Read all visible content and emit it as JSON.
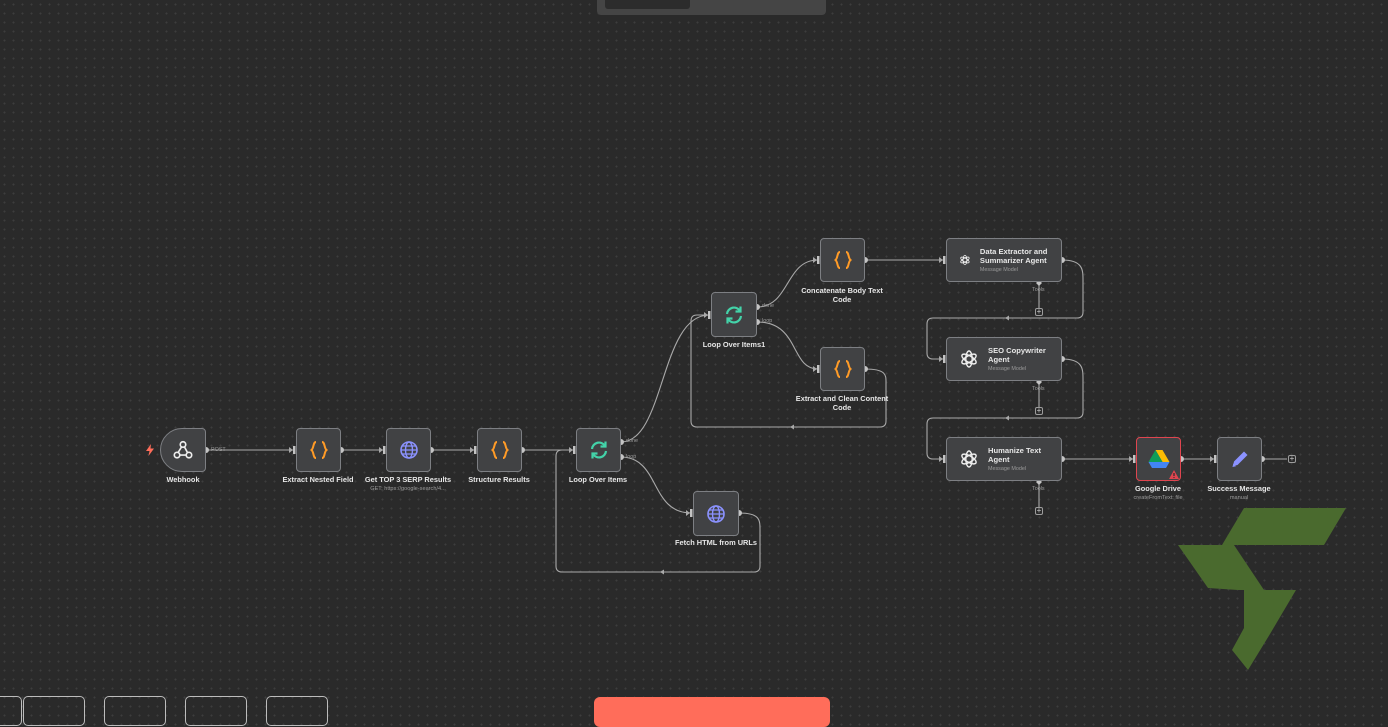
{
  "colors": {
    "canvas": "#2a2a2a",
    "node_fill": "#414244",
    "node_border": "#7d7f83",
    "edge": "#a9a9a9",
    "code_icon": "#ff9b27",
    "loop_icon": "#43d3a9",
    "http_icon": "#8b92ff",
    "set_icon": "#8b92ff",
    "error_border": "#e0454f",
    "primary_button": "#ff6d5a",
    "watermark": "#4a6a2e"
  },
  "nodes": {
    "webhook": {
      "label": "Webhook",
      "icon": "webhook-icon",
      "port_label": "POST"
    },
    "extract_nested": {
      "label": "Extract Nested Field",
      "icon": "code-braces-icon"
    },
    "serp": {
      "label": "Get TOP 3 SERP Results",
      "sub": "GET: https://google-search/4...",
      "icon": "globe-icon"
    },
    "structure": {
      "label": "Structure Results",
      "icon": "code-braces-icon"
    },
    "loop": {
      "label": "Loop Over Items",
      "icon": "loop-icon",
      "port_done": "done",
      "port_loop": "loop"
    },
    "fetch_html": {
      "label": "Fetch HTML from URLs",
      "icon": "globe-icon"
    },
    "loop1": {
      "label": "Loop Over Items1",
      "icon": "loop-icon",
      "port_done": "done",
      "port_loop": "loop"
    },
    "concat": {
      "label": "Concatenate Body Text Code",
      "icon": "code-braces-icon"
    },
    "clean": {
      "label": "Extract and Clean Content Code",
      "icon": "code-braces-icon"
    },
    "agent1": {
      "title": "Data Extractor and Summarizer Agent",
      "sub": "Message Model",
      "tools": "Tools",
      "icon": "openai-icon"
    },
    "agent2": {
      "title": "SEO Copywriter Agent",
      "sub": "Message Model",
      "tools": "Tools",
      "icon": "openai-icon"
    },
    "agent3": {
      "title": "Humanize Text Agent",
      "sub": "Message Model",
      "tools": "Tools",
      "icon": "openai-icon"
    },
    "gdrive": {
      "label": "Google Drive",
      "sub": "createFromText: file",
      "icon": "google-drive-icon"
    },
    "success": {
      "label": "Success Message",
      "sub": "manual",
      "icon": "pencil-icon"
    }
  },
  "add_node_symbol": "+"
}
